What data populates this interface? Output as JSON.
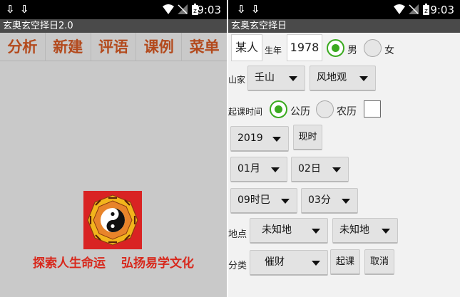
{
  "left": {
    "status_time": "9:03",
    "app_title": "玄奥玄空择日2.0",
    "menu": [
      "分析",
      "新建",
      "评语",
      "课例",
      "菜单"
    ],
    "slogan_1": "探索人生命运",
    "slogan_2": "弘扬易学文化"
  },
  "right": {
    "status_time": "9:03",
    "app_title": "玄奥玄空择日",
    "name_value": "某人",
    "birth_year_label": "生年",
    "birth_year_value": "1978",
    "gender_male": "男",
    "gender_female": "女",
    "gender_selected": "男",
    "shanjia_label": "山家",
    "shan_value": "壬山",
    "shan_feng_value": "风地观",
    "qike_label": "起课时间",
    "calendar_solar": "公历",
    "calendar_lunar": "农历",
    "calendar_selected": "公历",
    "year_value": "2019",
    "now_button": "现时",
    "month_value": "01月",
    "day_value": "02日",
    "hour_value": "09时巳",
    "minute_value": "03分",
    "place_label": "地点",
    "place_1": "未知地",
    "place_2": "未知地",
    "category_label": "分类",
    "category_value": "催财",
    "start_button": "起课",
    "cancel_button": "取消"
  },
  "colors": {
    "accent_green": "#3aaa1f",
    "menu_text": "#b34a1d",
    "slogan_red": "#d8281c"
  }
}
